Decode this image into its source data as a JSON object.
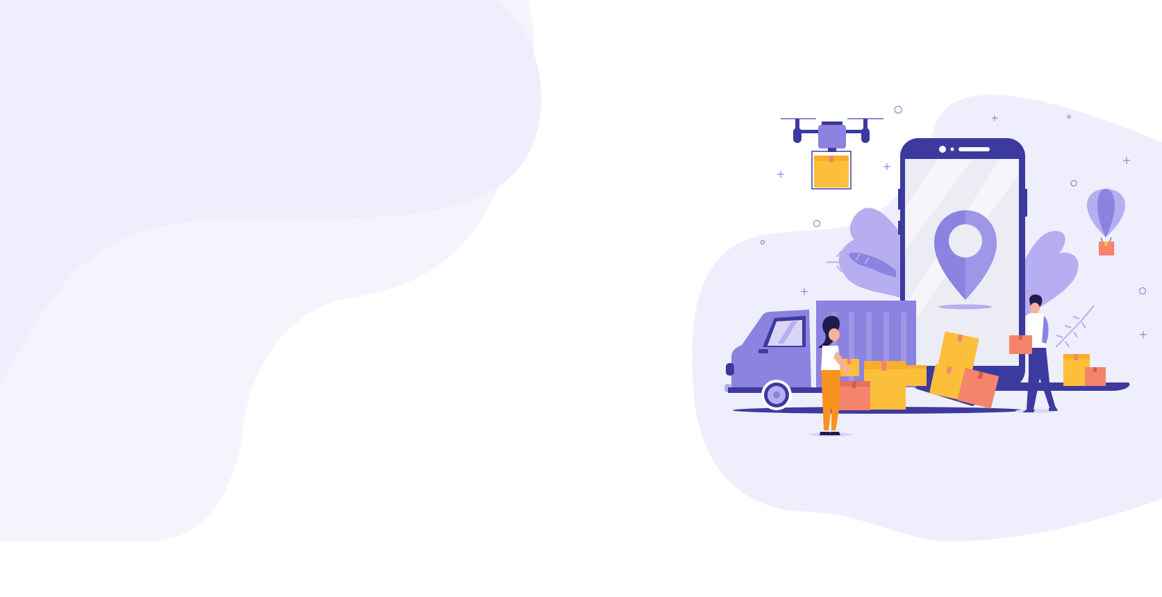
{
  "theme": {
    "background": "#ffffff",
    "blob_left_dark": "#efeefc",
    "blob_left_light": "#f4f4fd",
    "blob_right": "#efeefc",
    "purple_dark": "#3d3a9f",
    "purple": "#8c82e0",
    "purple_light": "#b6aef0",
    "yellow": "#fcbf3c",
    "orange": "#f4856a"
  },
  "illustration": {
    "subject": "delivery-tracking",
    "icons": [
      "drone-icon",
      "phone-icon",
      "location-pin-icon",
      "delivery-truck-icon",
      "package-box-icon",
      "hot-air-balloon-icon",
      "woman-courier-icon",
      "man-courier-icon"
    ]
  }
}
